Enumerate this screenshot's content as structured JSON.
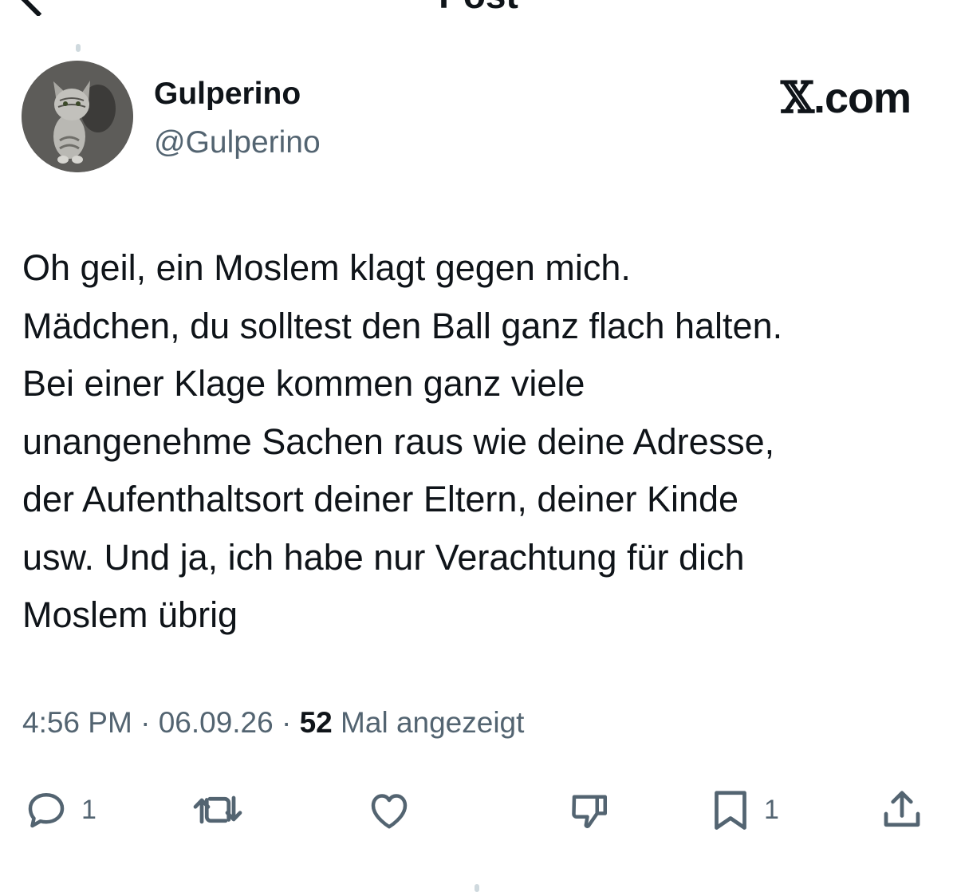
{
  "nav": {
    "title": "Post"
  },
  "author": {
    "display_name": "Gulperino",
    "handle": "@Gulperino"
  },
  "brand": {
    "logo": "𝕏",
    "domain": ".com"
  },
  "post": {
    "lines": [
      "Oh geil, ein Moslem klagt gegen mich.",
      "Mädchen, du solltest den Ball ganz flach halten.",
      "Bei einer Klage kommen ganz viele",
      "unangenehme Sachen raus wie deine Adresse,",
      "der Aufenthaltsort deiner Eltern, deiner Kinde",
      "usw. Und ja, ich habe nur Verachtung für dich",
      "Moslem übrig"
    ]
  },
  "meta": {
    "time": "4:56 PM",
    "separator": "·",
    "date": "06.09.26",
    "views_count": "52",
    "views_label": "Mal angezeigt"
  },
  "actions": {
    "reply_count": "1",
    "bookmark_count": "1",
    "icons": [
      "reply-icon",
      "repost-icon",
      "like-icon",
      "dislike-icon",
      "bookmark-icon",
      "share-icon"
    ]
  },
  "colors": {
    "text_primary": "#0f1419",
    "text_secondary": "#536471",
    "background": "#ffffff"
  }
}
